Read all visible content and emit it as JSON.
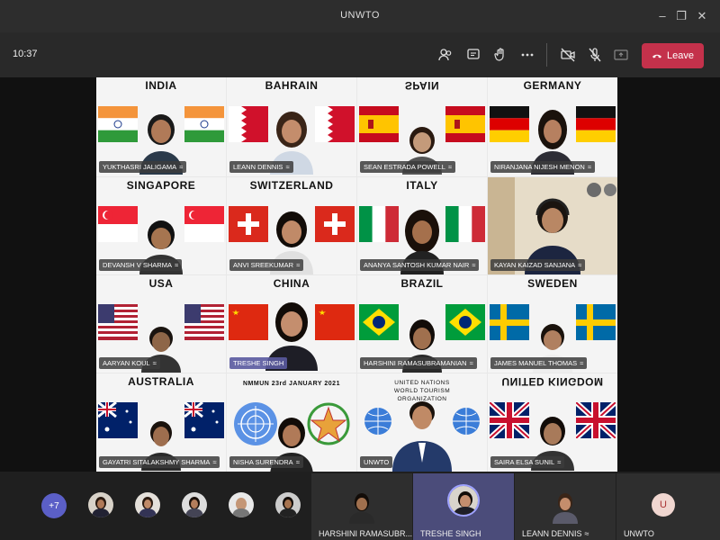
{
  "window": {
    "title": "UNWTO"
  },
  "toolbar": {
    "time": "10:37",
    "leave_label": "Leave"
  },
  "icons": [
    "participants-icon",
    "chat-icon",
    "raise-hand-icon",
    "more-icon",
    "camera-off-icon",
    "mic-off-icon",
    "share-icon",
    "phone-icon"
  ],
  "tiles": [
    {
      "country": "INDIA",
      "name": "YUKTHASRI JALIGAMA"
    },
    {
      "country": "BAHRAIN",
      "name": "LEANN DENNIS"
    },
    {
      "country": "SPAIN",
      "name": "SEAN ESTRADA POWELL"
    },
    {
      "country": "GERMANY",
      "name": "NIRANJANA NIJESH MENON"
    },
    {
      "country": "SINGAPORE",
      "name": "DEVANSH V SHARMA"
    },
    {
      "country": "SWITZERLAND",
      "name": "ANVI SREEKUMAR"
    },
    {
      "country": "ITALY",
      "name": "ANANYA SANTOSH KUMAR NAIR"
    },
    {
      "country": "",
      "name": "KAYAN KAIZAD SANJANA"
    },
    {
      "country": "USA",
      "name": "AARYAN KOUL"
    },
    {
      "country": "CHINA",
      "name": "TRESHE SINGH"
    },
    {
      "country": "BRAZIL",
      "name": "HARSHINI RAMASUBRAMANIAN"
    },
    {
      "country": "SWEDEN",
      "name": "JAMES MANUEL THOMAS"
    },
    {
      "country": "AUSTRALIA",
      "name": "GAYATRI SITALAKSHMY SHARMA"
    },
    {
      "country": "NMMUN 23rd JANUARY 2021",
      "name": "NISHA SURENDRA"
    },
    {
      "country": "UNITED NATIONS WORLD TOURISM ORGANIZATION",
      "name": "UNWTO"
    },
    {
      "country": "UNITED KINGDOM",
      "name": "SAIRA ELSA SUNIL"
    }
  ],
  "bottom": {
    "overflow_count": "+7",
    "video_tiles": [
      {
        "name": "HARSHINI RAMASUBR..."
      },
      {
        "name": "TRESHE SINGH"
      },
      {
        "name": "LEANN DENNIS"
      },
      {
        "name": "UNWTO",
        "initials": "U"
      }
    ]
  },
  "colors": {
    "leave": "#c4314b",
    "accent": "#5b5fc7"
  }
}
